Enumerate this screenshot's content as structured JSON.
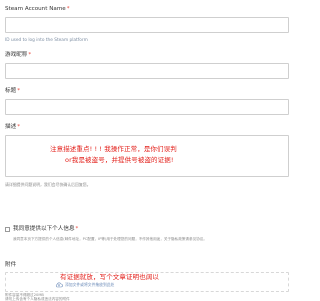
{
  "form": {
    "steam_name": {
      "label": "Steam Account Name",
      "required_mark": "*",
      "value": "",
      "hint": "ID used to log into the Steam platform"
    },
    "game_name": {
      "label": "游戏昵称",
      "required_mark": "*",
      "value": ""
    },
    "title": {
      "label": "标题",
      "required_mark": "*",
      "value": ""
    },
    "description": {
      "label": "描述",
      "required_mark": "*",
      "overlay_line1": "注意描述重点! ! ! 我操作正常，是你们误判",
      "overlay_line2": "or我是被盗号，并提供号被盗的证据!",
      "hint": "请详细提供问题说明，我们会尽快确认后回复您。"
    },
    "personal_info": {
      "checkbox_label": "我同意提供以下个人信息",
      "required_mark": "*",
      "hint": "我同意本页下方提供的个人信息(邮件地址，PC配置，IP等)用于处理您的问题，不作其他用途，关于隐私政策请参见协议。",
      "checked": false
    },
    "attachment": {
      "label": "附件",
      "overlay_text": "有证据就放，写个文章证明也阔以",
      "upload_text": "添加文件或将文件拖放到此处",
      "hint1": "附件容量不得超过20MB",
      "hint2": "请勿上传含有个人隐私或违法内容的附件"
    }
  },
  "colors": {
    "required": "#e8463a",
    "overlay_red": "#e3201b",
    "border": "#cfcfcf",
    "hint": "#8a8a8a",
    "upload_link": "#6a8ab8"
  },
  "icons": {
    "upload": "cloud-upload-icon"
  }
}
